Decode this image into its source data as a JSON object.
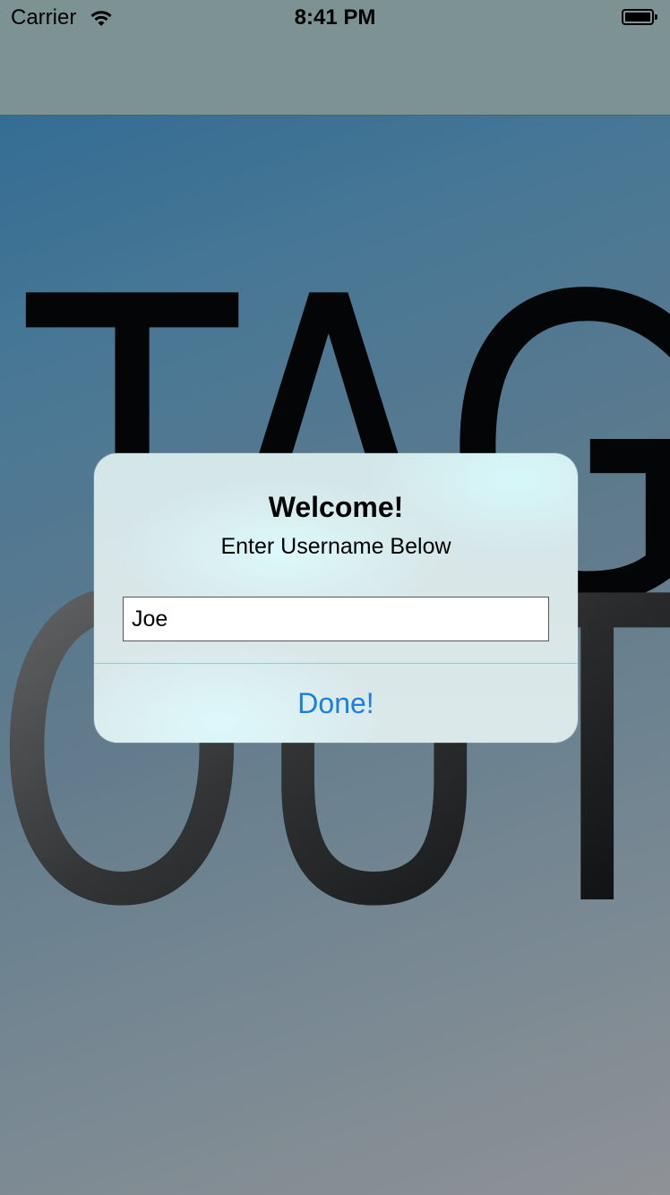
{
  "status_bar": {
    "carrier": "Carrier",
    "time": "8:41 PM",
    "wifi_icon": "wifi-icon",
    "battery_icon": "battery-icon"
  },
  "logo": {
    "line1": "TAG",
    "line2": "OUT"
  },
  "alert": {
    "title": "Welcome!",
    "message": "Enter Username Below",
    "input_value": "Joe",
    "button_label": "Done!"
  },
  "colors": {
    "accent": "#1a7fe0",
    "nav_bar": "#7d9393"
  }
}
